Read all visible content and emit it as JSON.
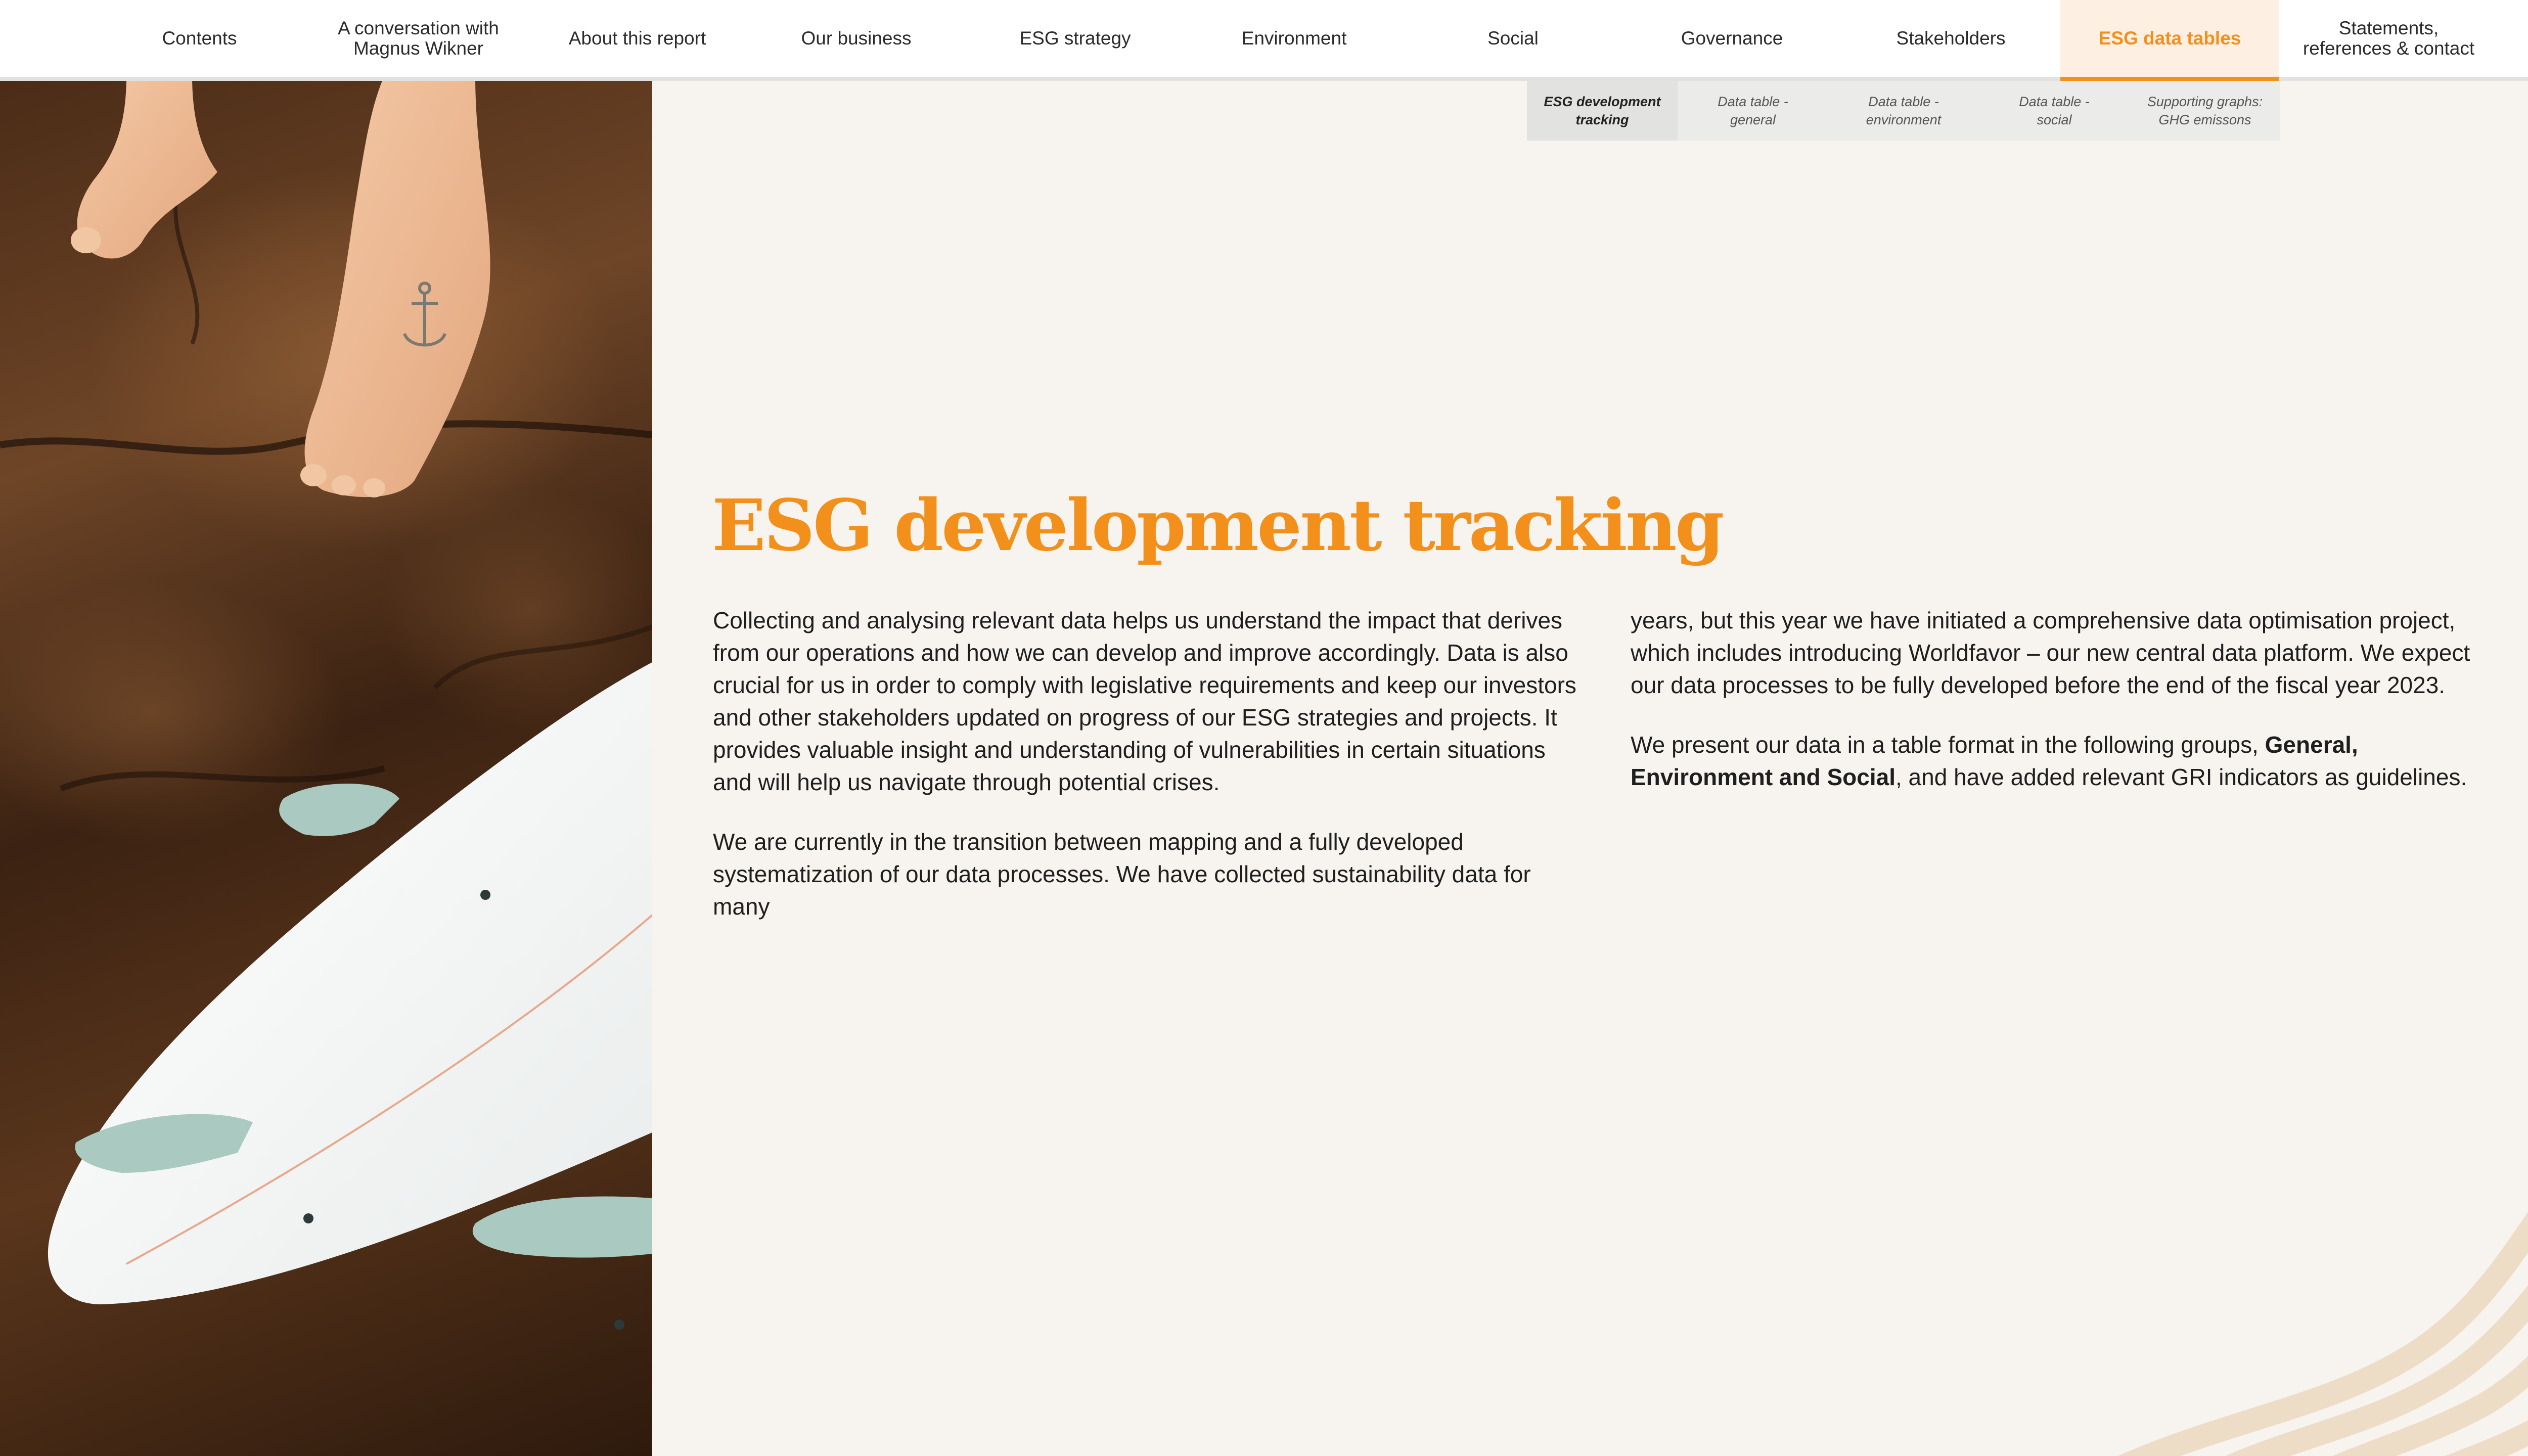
{
  "nav": {
    "items": [
      {
        "label": "Contents"
      },
      {
        "label": "A conversation with\nMagnus Wikner"
      },
      {
        "label": "About this report"
      },
      {
        "label": "Our business"
      },
      {
        "label": "ESG strategy"
      },
      {
        "label": "Environment"
      },
      {
        "label": "Social"
      },
      {
        "label": "Governance"
      },
      {
        "label": "Stakeholders"
      },
      {
        "label": "ESG data tables"
      },
      {
        "label": "Statements,\nreferences & contact"
      }
    ],
    "active_index": 9
  },
  "subnav": {
    "items": [
      {
        "label": "ESG development\ntracking"
      },
      {
        "label": "Data table -\ngeneral"
      },
      {
        "label": "Data table -\nenvironment"
      },
      {
        "label": "Data table -\nsocial"
      },
      {
        "label": "Supporting graphs:\nGHG emissons"
      }
    ],
    "active_index": 0
  },
  "page": {
    "title": "ESG development tracking",
    "left_p1": "Collecting and analysing relevant data helps us understand the impact that derives from our operations and how we can develop and improve accordingly. Data is also crucial for us in order to comply with legislative requirements and keep our investors and other stakeholders updated on progress of our ESG strategies and projects. It provides valuable insight and understanding of vulnerabilities in certain situations and will help us navigate through potential crises.",
    "left_p2": "We are currently in the transition between mapping and a fully developed systematization of our data processes. We have collected sustainability data for many",
    "right_p1": "years, but this year we have initiated a comprehensive data optimisation project, which includes introducing Worldfavor – our new central data platform. We expect our data processes to be fully developed before the end of the fiscal year 2023.",
    "right_p2_before": "We present our data in a table format in the following groups, ",
    "right_p2_bold": "General, Environment and Social",
    "right_p2_after": ", and have added relevant GRI indicators as guidelines."
  },
  "colors": {
    "accent": "#f3901b",
    "background": "#f7f4ef",
    "active_tab_bg": "#fdf0e3",
    "wave": "#eddcc6"
  }
}
